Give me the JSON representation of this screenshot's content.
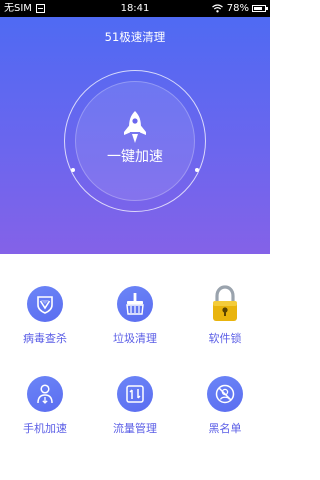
{
  "status_bar": {
    "carrier": "无SIM",
    "time": "18:41",
    "battery": "78%"
  },
  "header": {
    "title": "51极速清理"
  },
  "boost": {
    "label": "一键加速",
    "icon": "rocket-icon"
  },
  "features": [
    {
      "label": "病毒查杀",
      "icon": "shield-check-icon"
    },
    {
      "label": "垃圾清理",
      "icon": "broom-icon"
    },
    {
      "label": "软件锁",
      "icon": "padlock-icon"
    },
    {
      "label": "手机加速",
      "icon": "person-speed-icon"
    },
    {
      "label": "流量管理",
      "icon": "traffic-icon"
    },
    {
      "label": "黑名单",
      "icon": "blocked-user-icon"
    }
  ],
  "colors": {
    "gradient_top": "#4f6af3",
    "gradient_bottom": "#8462e8",
    "accent": "#5a5de6",
    "icon_circle": "#5b6df0",
    "lock_gold": "#e9b40d"
  }
}
